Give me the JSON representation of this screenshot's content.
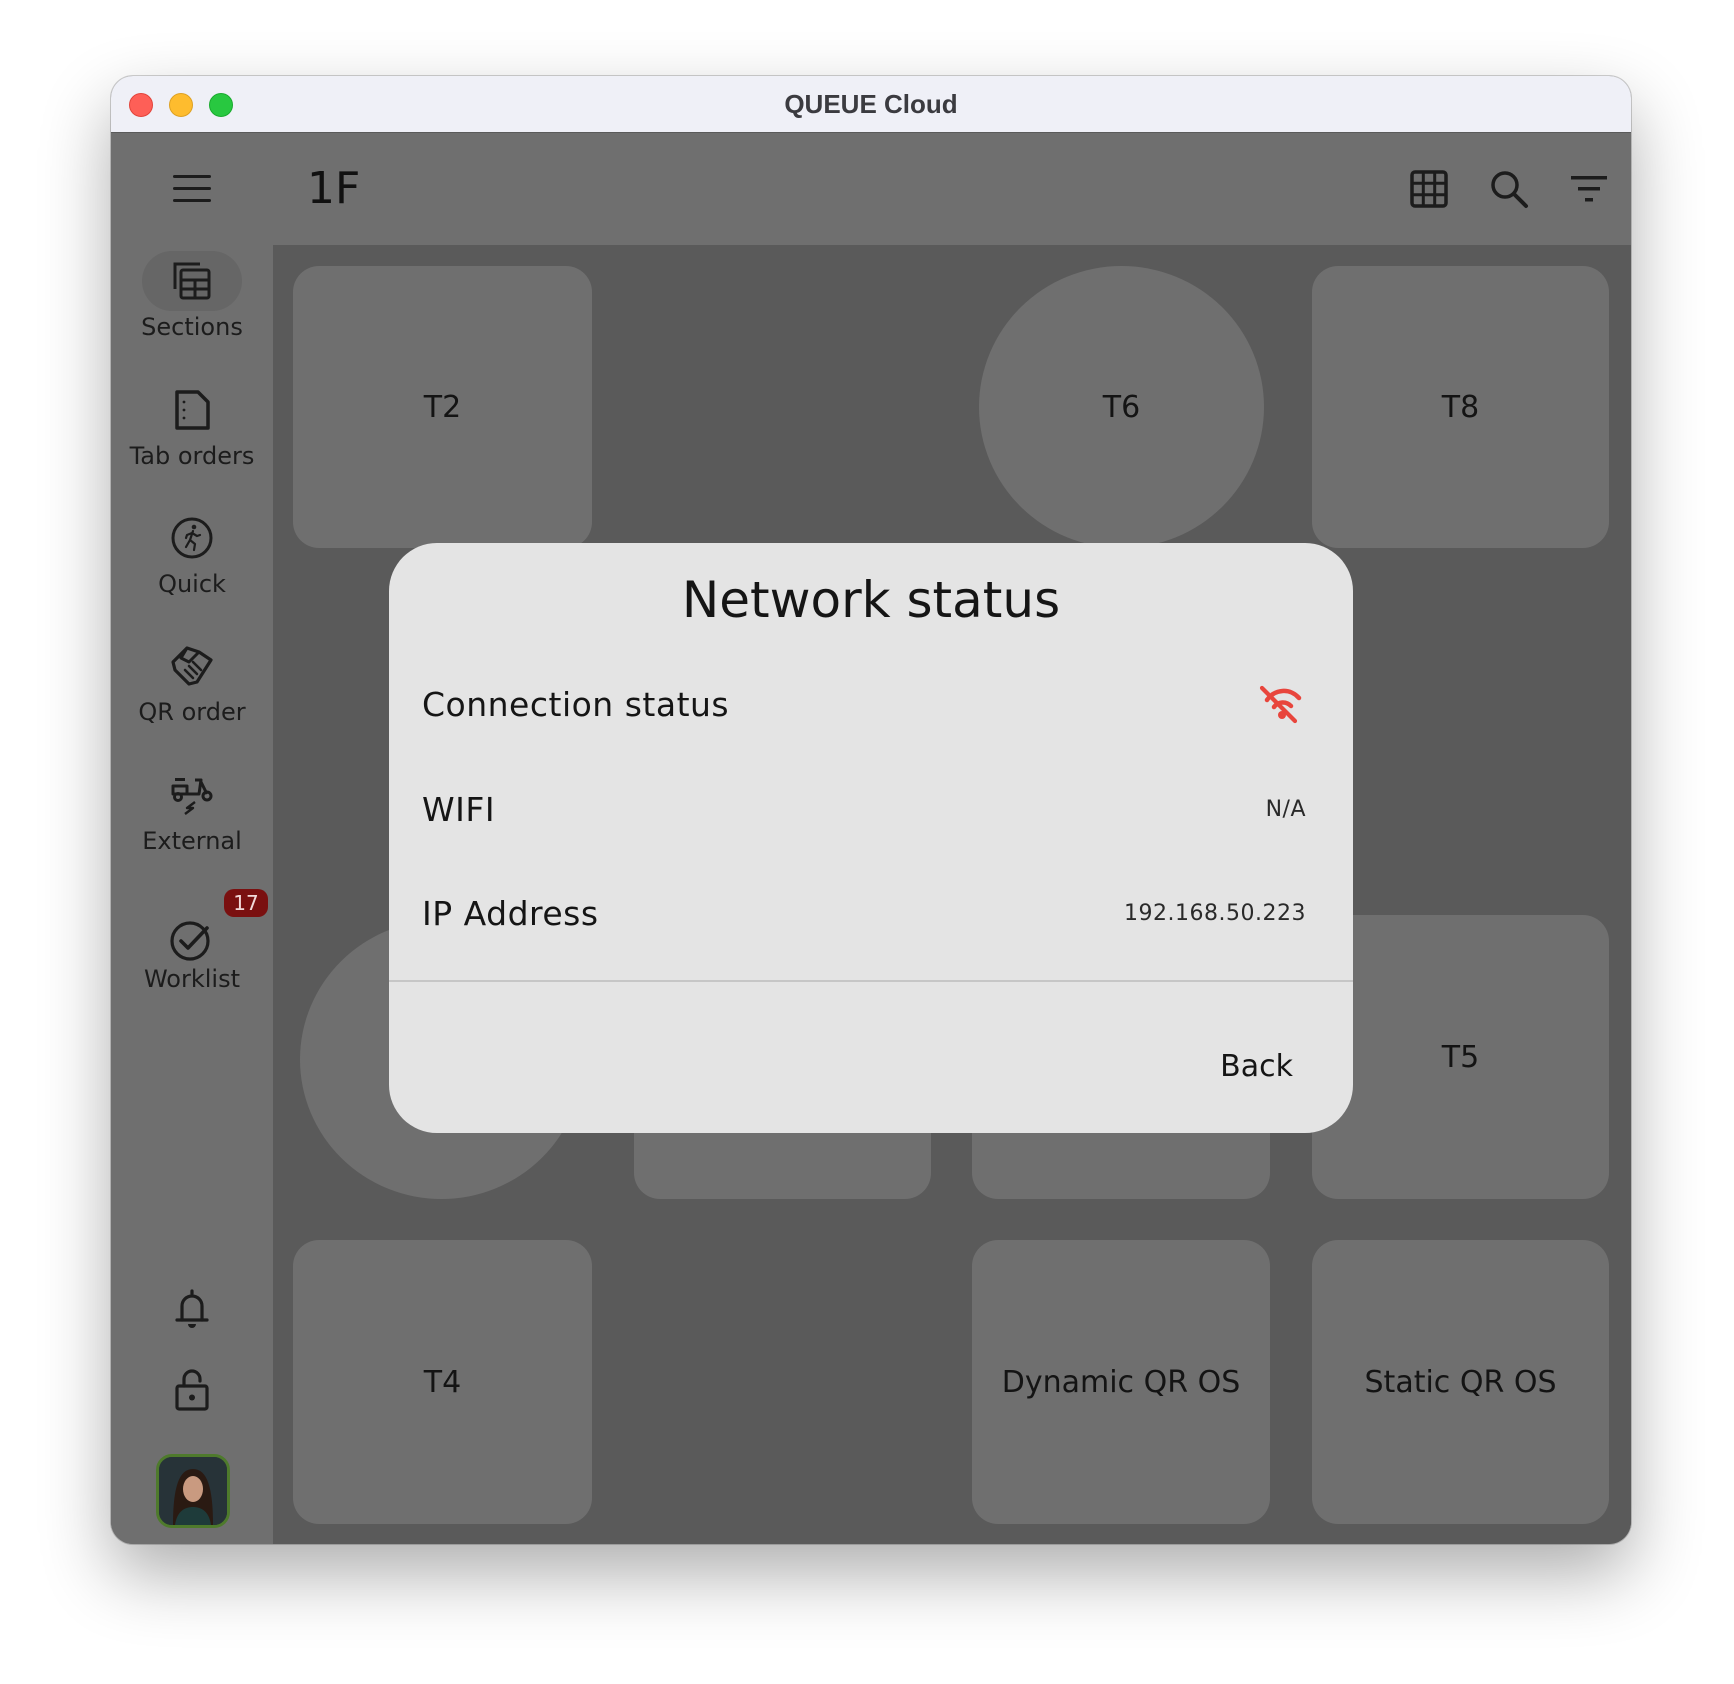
{
  "window": {
    "title": "QUEUE Cloud",
    "traffic_lights": [
      "close",
      "minimize",
      "zoom"
    ]
  },
  "header": {
    "title": "1F",
    "menu_icon": "hamburger-menu-icon",
    "actions": [
      {
        "name": "grid-view",
        "icon": "grid-icon"
      },
      {
        "name": "search",
        "icon": "search-icon"
      },
      {
        "name": "filter",
        "icon": "filter-icon"
      }
    ]
  },
  "sidebar": {
    "items": [
      {
        "label": "Sections",
        "icon": "sections-table-icon",
        "active": true
      },
      {
        "label": "Tab orders",
        "icon": "document-icon",
        "active": false
      },
      {
        "label": "Quick",
        "icon": "running-person-icon",
        "active": false
      },
      {
        "label": "QR order",
        "icon": "handshake-icon",
        "active": false
      },
      {
        "label": "External",
        "icon": "scooter-delivery-icon",
        "active": false
      },
      {
        "label": "Worklist",
        "icon": "check-circle-icon",
        "active": false,
        "badge": "17"
      }
    ],
    "bottom": [
      {
        "name": "notifications",
        "icon": "bell-icon"
      },
      {
        "name": "lock",
        "icon": "unlock-icon"
      },
      {
        "name": "network-status",
        "icon": "wifi-off-icon"
      }
    ],
    "avatar": "user-avatar"
  },
  "tables": [
    {
      "label": "T2",
      "shape": "rect"
    },
    {
      "label": "T6",
      "shape": "round"
    },
    {
      "label": "T8",
      "shape": "rect"
    },
    {
      "label": "",
      "shape": "round"
    },
    {
      "label": "",
      "shape": "rect"
    },
    {
      "label": "",
      "shape": "rect"
    },
    {
      "label": "T5",
      "shape": "rect"
    },
    {
      "label": "T4",
      "shape": "rect"
    },
    {
      "label": "Dynamic QR OS",
      "shape": "rect"
    },
    {
      "label": "Static QR OS",
      "shape": "rect"
    }
  ],
  "dialog": {
    "title": "Network status",
    "rows": [
      {
        "label": "Connection status",
        "value_icon": "wifi-off-icon"
      },
      {
        "label": "WIFI",
        "value": "N/A"
      },
      {
        "label": "IP Address",
        "value": "192.168.50.223"
      }
    ],
    "back_label": "Back"
  },
  "colors": {
    "offline_red": "#e8453c",
    "badge_bg": "#7a1010",
    "dialog_bg": "#e4e4e4",
    "canvas_bg": "#5a5a5a",
    "tile_bg": "#6f6f6f"
  }
}
